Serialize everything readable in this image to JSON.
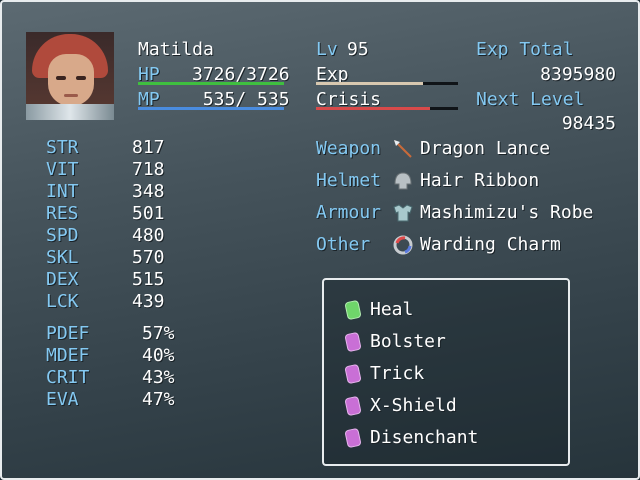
{
  "character": {
    "name": "Matilda",
    "hp_label": "HP",
    "hp_value": "3726/3726",
    "hp_fraction": 1.0,
    "mp_label": "MP",
    "mp_value": " 535/ 535",
    "mp_fraction": 1.0,
    "level_label": "Lv",
    "level_value": "95",
    "exp_label": "Exp",
    "exp_fraction": 0.75,
    "crisis_label": "Crisis",
    "crisis_fraction": 0.8,
    "exp_total_label": "Exp Total",
    "exp_total_value": "8395980",
    "next_level_label": "Next Level",
    "next_level_value": "98435"
  },
  "stats": [
    {
      "label": "STR",
      "value": "817"
    },
    {
      "label": "VIT",
      "value": "718"
    },
    {
      "label": "INT",
      "value": "348"
    },
    {
      "label": "RES",
      "value": "501"
    },
    {
      "label": "SPD",
      "value": "480"
    },
    {
      "label": "SKL",
      "value": "570"
    },
    {
      "label": "DEX",
      "value": "515"
    },
    {
      "label": "LCK",
      "value": "439"
    }
  ],
  "rates": [
    {
      "label": "PDEF",
      "value": "57%"
    },
    {
      "label": "MDEF",
      "value": "40%"
    },
    {
      "label": "CRIT",
      "value": "43%"
    },
    {
      "label": "EVA",
      "value": "47%"
    }
  ],
  "equipment": [
    {
      "slot": "Weapon",
      "item": "Dragon Lance",
      "icon": "lance-icon"
    },
    {
      "slot": "Helmet",
      "item": "Hair Ribbon",
      "icon": "helmet-icon"
    },
    {
      "slot": "Armour",
      "item": "Mashimizu's Robe",
      "icon": "armor-icon"
    },
    {
      "slot": "Other",
      "item": "Warding Charm",
      "icon": "charm-icon"
    }
  ],
  "skills": [
    {
      "name": "Heal",
      "gem_color": "#6fd66a",
      "icon": "green-gem-icon"
    },
    {
      "name": "Bolster",
      "gem_color": "#c96fd6",
      "icon": "purple-gem-icon"
    },
    {
      "name": "Trick",
      "gem_color": "#c96fd6",
      "icon": "purple-gem-icon"
    },
    {
      "name": "X-Shield",
      "gem_color": "#c96fd6",
      "icon": "purple-gem-icon"
    },
    {
      "name": "Disenchant",
      "gem_color": "#c96fd6",
      "icon": "purple-gem-icon"
    }
  ],
  "colors": {
    "system_text": "#84c9f2",
    "hp_bar": "#3fbf3f",
    "mp_bar": "#4a8cdf",
    "exp_bar": "#d8c8b0",
    "crisis_bar": "#d84a4a"
  }
}
